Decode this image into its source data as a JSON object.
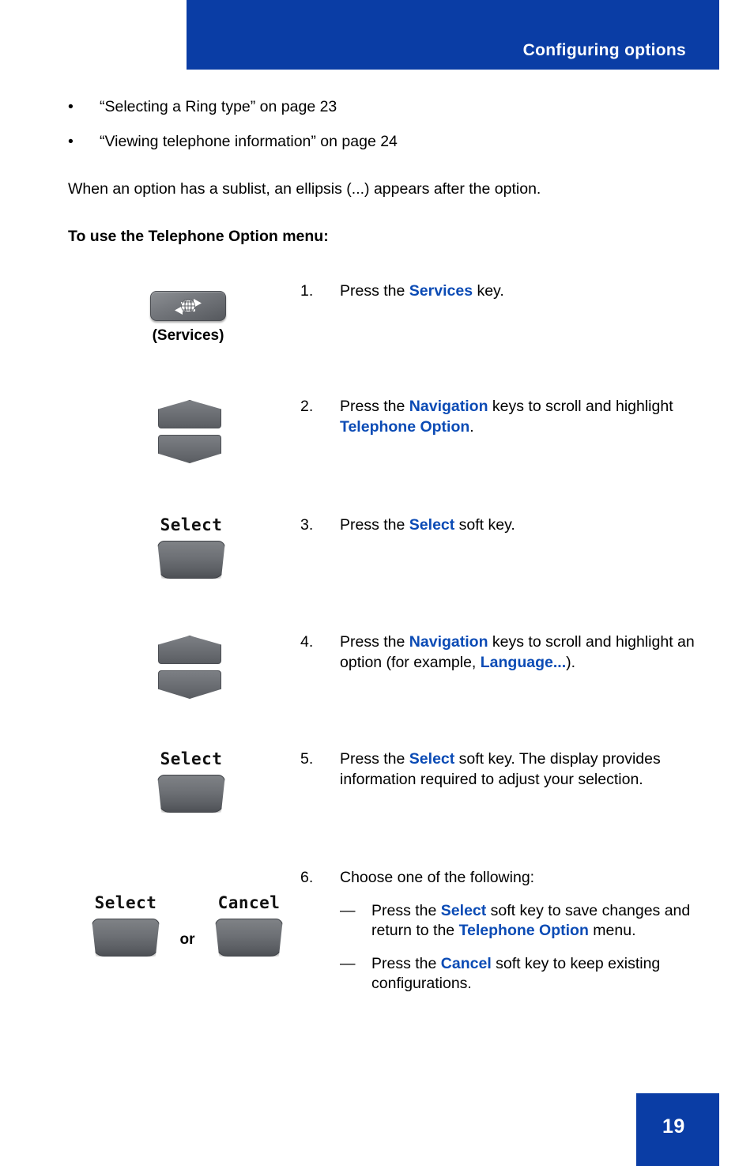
{
  "header": {
    "title": "Configuring options"
  },
  "footer": {
    "page_number": "19"
  },
  "colors": {
    "brand_blue": "#0A3DA5",
    "link_blue": "#0B4BB5",
    "key_gray": "#6d7075"
  },
  "intro": {
    "bullets": [
      {
        "marker": "•",
        "text": "“Selecting a Ring type” on page 23"
      },
      {
        "marker": "•",
        "text": "“Viewing telephone information” on page 24"
      }
    ],
    "paragraph": "When an option has a sublist, an ellipsis (...) appears after the option.",
    "heading": "To use the Telephone Option menu:"
  },
  "steps": [
    {
      "number": "1.",
      "art": "services-key",
      "art_label": "(Services)",
      "text_parts": [
        {
          "t": "Press the ",
          "style": "normal"
        },
        {
          "t": "Services",
          "style": "blue"
        },
        {
          "t": " key.",
          "style": "normal"
        }
      ]
    },
    {
      "number": "2.",
      "art": "navigation-keys",
      "art_label": "",
      "text_parts": [
        {
          "t": "Press the ",
          "style": "normal"
        },
        {
          "t": "Navigation",
          "style": "blue"
        },
        {
          "t": " keys to scroll and highlight ",
          "style": "normal"
        },
        {
          "t": "Telephone Option",
          "style": "blue"
        },
        {
          "t": ".",
          "style": "normal"
        }
      ]
    },
    {
      "number": "3.",
      "art": "softkey",
      "art_label": "Select",
      "text_parts": [
        {
          "t": "Press the ",
          "style": "normal"
        },
        {
          "t": "Select",
          "style": "blue"
        },
        {
          "t": " soft key.",
          "style": "normal"
        }
      ]
    },
    {
      "number": "4.",
      "art": "navigation-keys",
      "art_label": "",
      "text_parts": [
        {
          "t": "Press the ",
          "style": "normal"
        },
        {
          "t": "Navigation",
          "style": "blue"
        },
        {
          "t": " keys to scroll and highlight an option (for example, ",
          "style": "normal"
        },
        {
          "t": "Language...",
          "style": "blue"
        },
        {
          "t": ").",
          "style": "normal"
        }
      ]
    },
    {
      "number": "5.",
      "art": "softkey",
      "art_label": "Select",
      "text_parts": [
        {
          "t": "Press the ",
          "style": "normal"
        },
        {
          "t": "Select",
          "style": "blue"
        },
        {
          "t": " soft key. The display provides information required to adjust your selection.",
          "style": "normal"
        }
      ]
    },
    {
      "number": "6.",
      "art": "dual-softkeys",
      "art_label": "",
      "text_parts": [
        {
          "t": "Choose one of the following:",
          "style": "normal"
        }
      ],
      "sub_items": [
        {
          "marker": "—",
          "parts": [
            {
              "t": "Press the ",
              "style": "normal"
            },
            {
              "t": "Select",
              "style": "blue"
            },
            {
              "t": " soft key to save changes and return to the ",
              "style": "normal"
            },
            {
              "t": "Telephone Option",
              "style": "blue"
            },
            {
              "t": " menu.",
              "style": "normal"
            }
          ]
        },
        {
          "marker": "—",
          "parts": [
            {
              "t": "Press the ",
              "style": "normal"
            },
            {
              "t": "Cancel",
              "style": "blue"
            },
            {
              "t": " soft key to keep existing configurations.",
              "style": "normal"
            }
          ]
        }
      ]
    }
  ],
  "artwork": {
    "services_key_label": "(Services)",
    "services_icon": "globe-arrows-icon",
    "navigation_up_icon": "chevron-up-key",
    "navigation_down_icon": "chevron-down-key",
    "softkey_select_label": "Select",
    "softkey_cancel_label": "Cancel",
    "or_label": "or"
  }
}
